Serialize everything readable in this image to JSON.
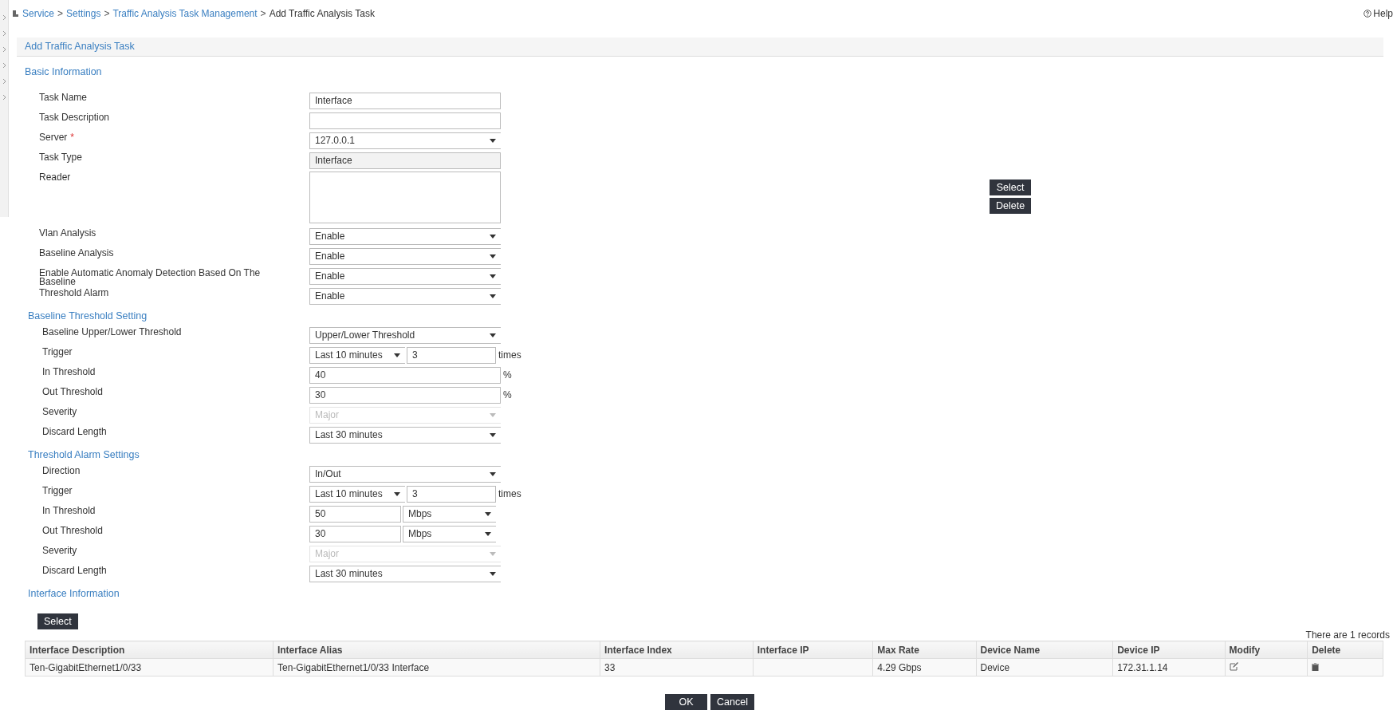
{
  "breadcrumb": {
    "links": [
      "Service",
      "Settings",
      "Traffic Analysis Task Management"
    ],
    "separator": ">",
    "current": "Add Traffic Analysis Task"
  },
  "help": "Help",
  "required_mark": "*",
  "panel_title": "Add Traffic Analysis Task",
  "sections": [
    {
      "title": "Basic Information",
      "rows": [
        {
          "label": "Task Name",
          "required": false,
          "controls": [
            {
              "kind": "input",
              "value": "Interface"
            }
          ]
        },
        {
          "label": "Task Description",
          "required": false,
          "controls": [
            {
              "kind": "input"
            }
          ]
        },
        {
          "label": "Server",
          "required": true,
          "controls": [
            {
              "kind": "select",
              "value": "127.0.0.1",
              "disabled": false
            }
          ]
        },
        {
          "label": "Task Type",
          "required": false,
          "controls": [
            {
              "kind": "readonly",
              "value": "Interface"
            }
          ]
        },
        {
          "label": "Reader",
          "required": false,
          "controls": [
            {
              "kind": "textarea"
            }
          ],
          "actions": [
            "Select",
            "Delete"
          ]
        },
        {
          "label": "Vlan Analysis",
          "required": false,
          "controls": [
            {
              "kind": "select",
              "value": "Enable",
              "disabled": false
            }
          ]
        },
        {
          "label": "Baseline Analysis",
          "required": false,
          "controls": [
            {
              "kind": "select",
              "value": "Enable",
              "disabled": false
            }
          ]
        },
        {
          "label": "Enable Automatic Anomaly Detection Based On The Baseline",
          "required": false,
          "controls": [
            {
              "kind": "select",
              "value": "Enable",
              "disabled": false
            }
          ]
        },
        {
          "label": "Threshold Alarm",
          "required": false,
          "controls": [
            {
              "kind": "select",
              "value": "Enable",
              "disabled": false
            }
          ]
        }
      ]
    },
    {
      "title": "Baseline Threshold Setting",
      "rows": [
        {
          "label": "Baseline Upper/Lower Threshold",
          "required": false,
          "controls": [
            {
              "kind": "select",
              "value": "Upper/Lower Threshold",
              "disabled": false
            }
          ]
        },
        {
          "label": "Trigger",
          "required": false,
          "controls": [
            {
              "kind": "select",
              "value": "Last 10 minutes",
              "disabled": false
            },
            {
              "kind": "input",
              "value": "3"
            },
            {
              "kind": "unit",
              "text": "times"
            }
          ]
        },
        {
          "label": "In Threshold",
          "required": false,
          "controls": [
            {
              "kind": "input",
              "value": "40"
            },
            {
              "kind": "unit",
              "text": "%"
            }
          ]
        },
        {
          "label": "Out Threshold",
          "required": false,
          "controls": [
            {
              "kind": "input",
              "value": "30"
            },
            {
              "kind": "unit",
              "text": "%"
            }
          ]
        },
        {
          "label": "Severity",
          "required": false,
          "controls": [
            {
              "kind": "select",
              "value": "Major",
              "disabled": true
            }
          ]
        },
        {
          "label": "Discard Length",
          "required": false,
          "controls": [
            {
              "kind": "select",
              "value": "Last 30 minutes",
              "disabled": false
            }
          ]
        }
      ]
    },
    {
      "title": "Threshold Alarm Settings",
      "rows": [
        {
          "label": "Direction",
          "required": false,
          "controls": [
            {
              "kind": "select",
              "value": "In/Out",
              "disabled": false
            }
          ]
        },
        {
          "label": "Trigger",
          "required": false,
          "controls": [
            {
              "kind": "select",
              "value": "Last 10 minutes",
              "disabled": false
            },
            {
              "kind": "input",
              "value": "3"
            },
            {
              "kind": "unit",
              "text": "times"
            }
          ]
        },
        {
          "label": "In Threshold",
          "required": false,
          "controls": [
            {
              "kind": "input",
              "value": "50"
            },
            {
              "kind": "select",
              "value": "Mbps",
              "disabled": false
            }
          ]
        },
        {
          "label": "Out Threshold",
          "required": false,
          "controls": [
            {
              "kind": "input",
              "value": "30"
            },
            {
              "kind": "select",
              "value": "Mbps",
              "disabled": false
            }
          ]
        },
        {
          "label": "Severity",
          "required": false,
          "controls": [
            {
              "kind": "select",
              "value": "Major",
              "disabled": true
            }
          ]
        },
        {
          "label": "Discard Length",
          "required": false,
          "controls": [
            {
              "kind": "select",
              "value": "Last 30 minutes",
              "disabled": false
            }
          ]
        }
      ]
    }
  ],
  "interface_info": {
    "title": "Interface Information",
    "select_button": "Select",
    "record_count": "There are 1 records",
    "table": {
      "columns": [
        "Interface Description",
        "Interface Alias",
        "Interface Index",
        "Interface IP",
        "Max Rate",
        "Device Name",
        "Device IP",
        "Modify",
        "Delete"
      ],
      "rows": [
        {
          "cells": [
            "Ten-GigabitEthernet1/0/33",
            "Ten-GigabitEthernet1/0/33 Interface",
            "33",
            "",
            "4.29 Gbps",
            "Device",
            "172.31.1.14"
          ]
        }
      ]
    }
  },
  "buttons": [
    "OK",
    "Cancel"
  ]
}
